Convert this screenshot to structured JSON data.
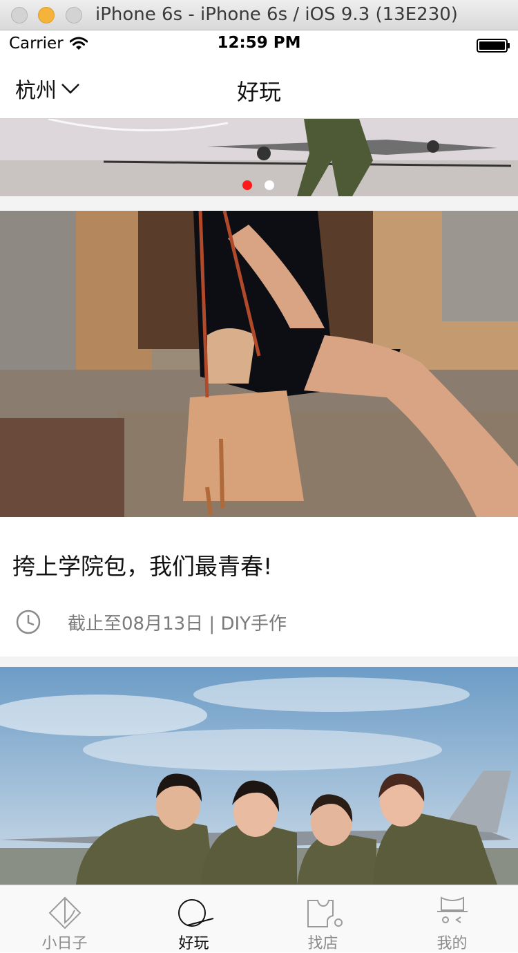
{
  "simulator": {
    "title": "iPhone 6s - iPhone 6s / iOS 9.3 (13E230)"
  },
  "status_bar": {
    "carrier": "Carrier",
    "time": "12:59 PM",
    "wifi_icon": "wifi-icon",
    "battery_icon": "battery-icon"
  },
  "nav": {
    "city": "杭州",
    "city_icon": "chevron-down-icon",
    "title": "好玩"
  },
  "banner": {
    "page_count": 2,
    "active_page": 1,
    "active_dot_color": "#ff1a1a",
    "inactive_dot_color": "#ffffff"
  },
  "cards": [
    {
      "image": "woman-with-fringe-bucket-bag-photo",
      "title": "挎上学院包，我们最青春!",
      "meta_icon": "clock-icon",
      "meta": "截止至08月13日 | DIY手作"
    },
    {
      "image": "pilots-in-front-of-fighter-jet-photo"
    }
  ],
  "tabs": [
    {
      "label": "小日子",
      "icon": "diamond-pen-icon",
      "active": false
    },
    {
      "label": "好玩",
      "icon": "circle-swoosh-icon",
      "active": true
    },
    {
      "label": "找店",
      "icon": "puzzle-piece-icon",
      "active": false
    },
    {
      "label": "我的",
      "icon": "hat-face-icon",
      "active": false
    }
  ],
  "colors": {
    "tab_active": "#111111",
    "tab_inactive": "#8c8c8c",
    "meta_text": "#7a7a7a"
  }
}
